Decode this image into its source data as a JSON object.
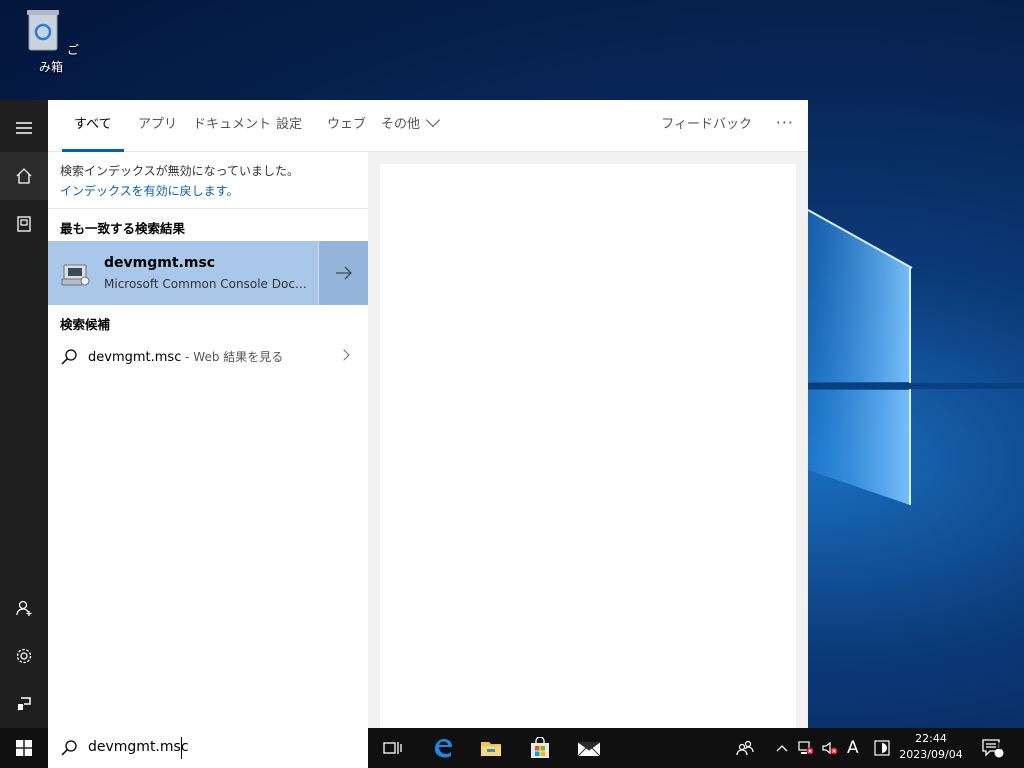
{
  "desktop": {
    "recycle_bin_label": "ごみ箱"
  },
  "search_panel": {
    "tabs": [
      {
        "label": "すべて",
        "active": true
      },
      {
        "label": "アプリ"
      },
      {
        "label": "ドキュメント"
      },
      {
        "label": "設定"
      },
      {
        "label": "ウェブ"
      },
      {
        "label": "その他"
      }
    ],
    "feedback_label": "フィードバック",
    "more_label": "···",
    "index_notice": "検索インデックスが無効になっていました。",
    "index_link": "インデックスを有効に戻します。",
    "best_match_title": "最も一致する検索結果",
    "best_match": {
      "name": "devmgmt.msc",
      "type": "Microsoft Common Console Document"
    },
    "suggestions_title": "検索候補",
    "suggestion": {
      "query": "devmgmt.msc",
      "suffix": " - Web 結果を見る"
    }
  },
  "taskbar": {
    "search_value": "devmgmt.msc",
    "ime_label": "A",
    "time": "22:44",
    "date": "2023/09/04",
    "notification_count": "1"
  },
  "colors": {
    "accent": "#0063b1",
    "selected_result": "#a9c7e8",
    "taskbar": "#101010",
    "rail": "#1f1f1f"
  }
}
